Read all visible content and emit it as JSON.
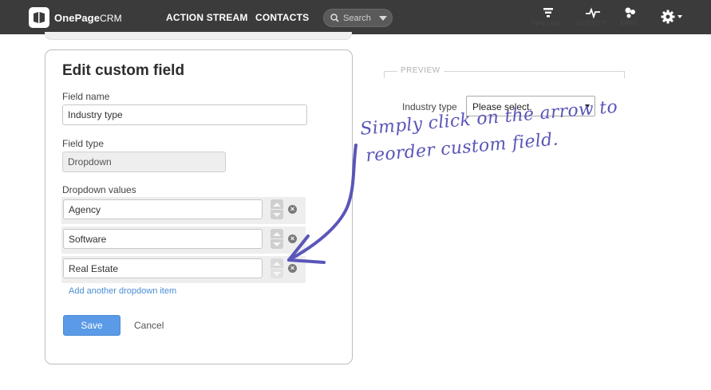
{
  "app": {
    "logo_name": "OnePage",
    "logo_suffix": "CRM"
  },
  "nav": {
    "action_stream": "ACTION STREAM",
    "contacts": "CONTACTS",
    "search_placeholder": "Search",
    "pipeline": "PIPELINE",
    "activity": "ACTIVITY",
    "apps": "APPS"
  },
  "panel": {
    "title": "Edit custom field",
    "field_name_label": "Field name",
    "field_name_value": "Industry type",
    "field_type_label": "Field type",
    "field_type_value": "Dropdown",
    "dropdown_values_label": "Dropdown values",
    "dropdown_values": [
      {
        "value": "Agency"
      },
      {
        "value": "Software"
      },
      {
        "value": "Real Estate"
      }
    ],
    "add_item_link": "Add another dropdown item",
    "save_label": "Save",
    "cancel_label": "Cancel"
  },
  "preview": {
    "heading": "PREVIEW",
    "field_label": "Industry type",
    "select_value": "Please select."
  },
  "annotation": {
    "line1": "Simply click on the arrow to",
    "line2": "reorder custom field."
  },
  "colors": {
    "topbar": "#3b3b3b",
    "accent": "#5a9ae6",
    "link": "#4a8ed6",
    "annotation": "#5a56b8"
  }
}
